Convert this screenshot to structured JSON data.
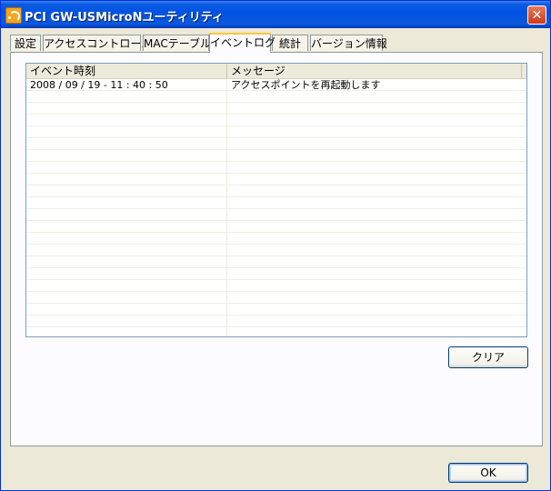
{
  "window": {
    "title": "PCI GW-USMicroNユーティリティ",
    "close_glyph": "✕",
    "title_bar_color": "#0054e3"
  },
  "tabs": [
    {
      "label": "設定"
    },
    {
      "label": "アクセスコントロール"
    },
    {
      "label": "MACテーブル"
    },
    {
      "label": "イベントログ"
    },
    {
      "label": "統計"
    },
    {
      "label": "バージョン情報"
    }
  ],
  "active_tab": "イベントログ",
  "event_log": {
    "columns": [
      "イベント時刻",
      "メッセージ"
    ],
    "rows": [
      {
        "time": "2008 / 09 / 19 - 11 : 40 : 50",
        "message": "アクセスポイントを再起動します"
      }
    ]
  },
  "buttons": {
    "clear_label": "クリア",
    "ok_label": "OK"
  },
  "icons": {
    "app": "wireless-utility-icon",
    "close": "close-icon"
  }
}
